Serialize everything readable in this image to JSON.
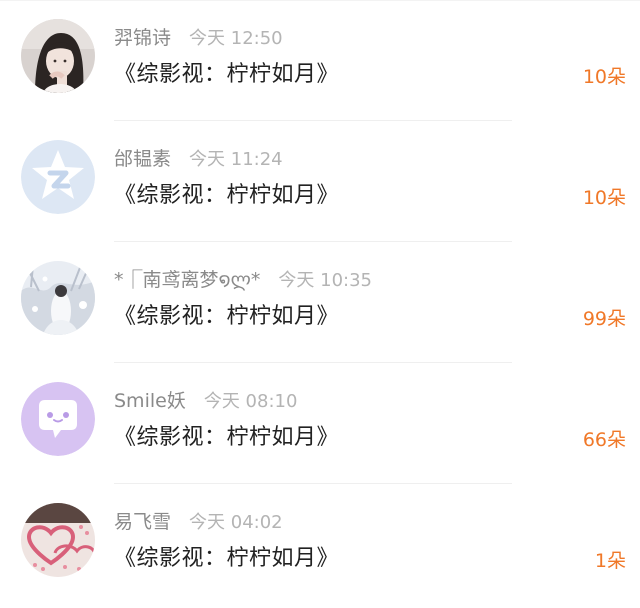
{
  "gifts": [
    {
      "name": "羿锦诗",
      "time": "今天 12:50",
      "title": "《综影视：柠柠如月》",
      "amount": "10朵",
      "avatar_icon": "girl-photo-avatar-icon"
    },
    {
      "name": "邰韫素",
      "time": "今天 11:24",
      "title": "《综影视：柠柠如月》",
      "amount": "10朵",
      "avatar_icon": "qq-default-avatar-icon"
    },
    {
      "name": "*⎾南鸢离梦໑ლ*",
      "time": "今天 10:35",
      "title": "《综影视：柠柠如月》",
      "amount": "99朵",
      "avatar_icon": "snow-scene-avatar-icon"
    },
    {
      "name": "Smile妖",
      "time": "今天 08:10",
      "title": "《综影视：柠柠如月》",
      "amount": "66朵",
      "avatar_icon": "chat-bubble-avatar-icon"
    },
    {
      "name": "易飞雪",
      "time": "今天 04:02",
      "title": "《综影视：柠柠如月》",
      "amount": "1朵",
      "avatar_icon": "heart-photo-avatar-icon"
    }
  ],
  "colors": {
    "amount": "#f07828",
    "name": "#8a8a8a",
    "time": "#b4b4b4",
    "title": "#222222"
  }
}
